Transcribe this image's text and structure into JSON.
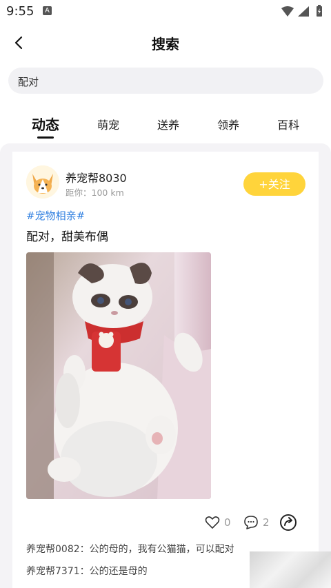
{
  "status_bar": {
    "time": "9:55",
    "notification_badge": "A"
  },
  "header": {
    "title": "搜索"
  },
  "search": {
    "value": "配对",
    "placeholder": ""
  },
  "tabs": [
    {
      "label": "动态",
      "active": true
    },
    {
      "label": "萌宠",
      "active": false
    },
    {
      "label": "送养",
      "active": false
    },
    {
      "label": "领养",
      "active": false
    },
    {
      "label": "百科",
      "active": false
    }
  ],
  "post": {
    "username": "养宠帮8030",
    "distance": "距你：100 km",
    "follow_label": "+关注",
    "topic": "#宠物相亲#",
    "text": "配对，甜美布偶",
    "like_count": "0",
    "comment_count": "2",
    "comments": [
      "养宠帮0082：公的母的，我有公猫猫，可以配对",
      "养宠帮7371：公的还是母的"
    ]
  },
  "colors": {
    "accent": "#ffd43b",
    "topic": "#2f7fe0",
    "feed_bg": "#f4f3f6"
  }
}
